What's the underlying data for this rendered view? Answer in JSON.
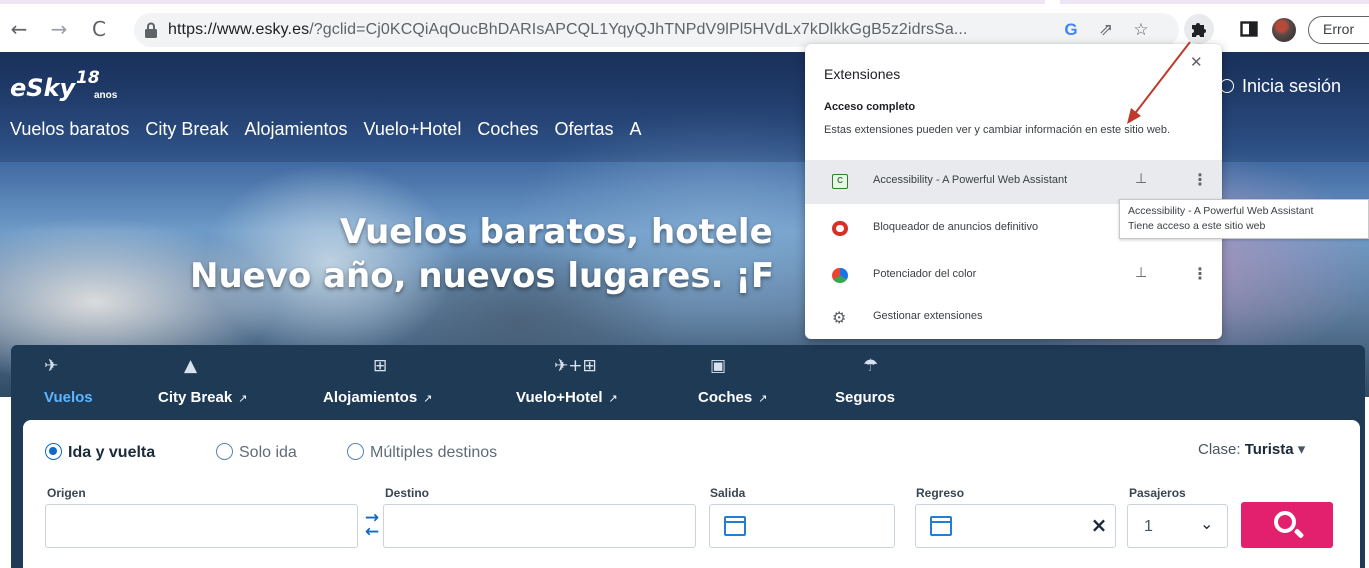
{
  "browser": {
    "url_host": "https://www.esky.es",
    "url_rest": "/?gclid=Cj0KCQiAqOucBhDARIsAPCQL1YqyQJhTNPdV9lPl5HVdLx7kDlkkGgB5z2idrsSa...",
    "google_icon": "G",
    "error_label": "Error"
  },
  "site": {
    "logo_text": "eSky",
    "logo_sup": "18",
    "logo_anos": "anos",
    "login_label": "Inicia sesión",
    "menu": [
      "Vuelos baratos",
      "City Break",
      "Alojamientos",
      "Vuelo+Hotel",
      "Coches",
      "Ofertas",
      "A"
    ],
    "headline_1": "Vuelos baratos, hotele",
    "headline_2": "Nuevo año, nuevos lugares. ¡F"
  },
  "tabs": [
    {
      "label": "Vuelos",
      "icon": "plane-icon",
      "active": true
    },
    {
      "label": "City Break",
      "icon": "eiffel-tower-icon",
      "external": true
    },
    {
      "label": "Alojamientos",
      "icon": "hotel-icon",
      "external": true
    },
    {
      "label": "Vuelo+Hotel",
      "icon": "plane-hotel-icon",
      "external": true
    },
    {
      "label": "Coches",
      "icon": "car-icon",
      "external": true
    },
    {
      "label": "Seguros",
      "icon": "umbrella-icon"
    }
  ],
  "search": {
    "trip_types": [
      "Ida y vuelta",
      "Solo ida",
      "Múltiples destinos"
    ],
    "selected_trip_type": "Ida y vuelta",
    "class_label": "Clase:",
    "class_value": "Turista",
    "origin_label": "Origen",
    "destination_label": "Destino",
    "departure_label": "Salida",
    "return_label": "Regreso",
    "passengers_label": "Pasajeros",
    "passengers_value": "1"
  },
  "extensions_popup": {
    "title": "Extensiones",
    "section_title": "Acceso completo",
    "section_desc": "Estas extensiones pueden ver y cambiar información en este sitio web.",
    "items": [
      {
        "name": "Accessibility - A Powerful Web Assistant",
        "icon": "accessibility-extension-icon",
        "pinned": true
      },
      {
        "name": "Bloqueador de anuncios definitivo",
        "icon": "ad-blocker-icon",
        "pinned": false
      },
      {
        "name": "Potenciador del color",
        "icon": "color-enhancer-icon",
        "pinned": true
      },
      {
        "name": "Gestionar extensiones",
        "icon": "gear-icon"
      }
    ],
    "tooltip_line1": "Accessibility - A Powerful Web Assistant",
    "tooltip_line2": "Tiene acceso a este sitio web"
  },
  "colors": {
    "accent": "#1268c4",
    "search_button": "#e3206d",
    "panel": "#1f3a55",
    "annotation_arrow": "#c0392b"
  }
}
